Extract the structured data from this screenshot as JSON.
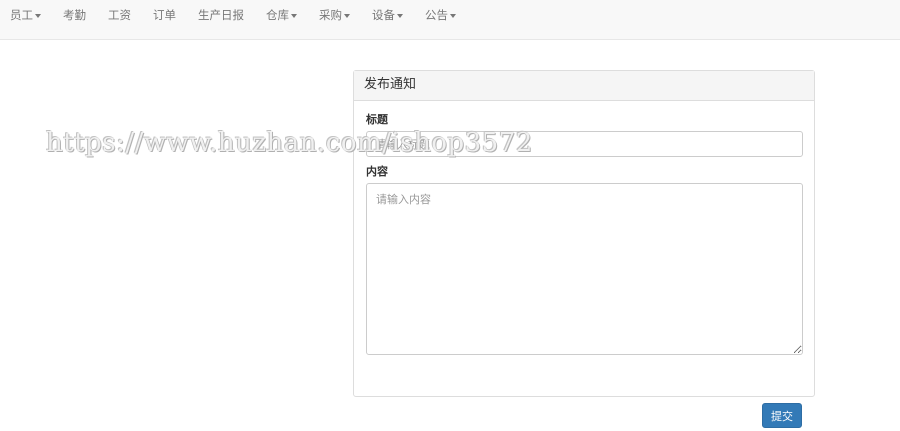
{
  "navbar": {
    "items": [
      {
        "label": "员工",
        "dropdown": true
      },
      {
        "label": "考勤",
        "dropdown": false
      },
      {
        "label": "工资",
        "dropdown": false
      },
      {
        "label": "订单",
        "dropdown": false
      },
      {
        "label": "生产日报",
        "dropdown": false
      },
      {
        "label": "仓库",
        "dropdown": true
      },
      {
        "label": "采购",
        "dropdown": true
      },
      {
        "label": "设备",
        "dropdown": true
      },
      {
        "label": "公告",
        "dropdown": true
      }
    ]
  },
  "panel": {
    "title": "发布通知",
    "title_label": "标题",
    "title_placeholder": "请输入标题",
    "content_label": "内容",
    "content_placeholder": "请输入内容",
    "submit_label": "提交"
  },
  "watermark": "https://www.huzhan.com/ishop3572",
  "colors": {
    "navbar_bg": "#f8f8f8",
    "primary": "#337ab7",
    "panel_heading_bg": "#f5f5f5"
  }
}
